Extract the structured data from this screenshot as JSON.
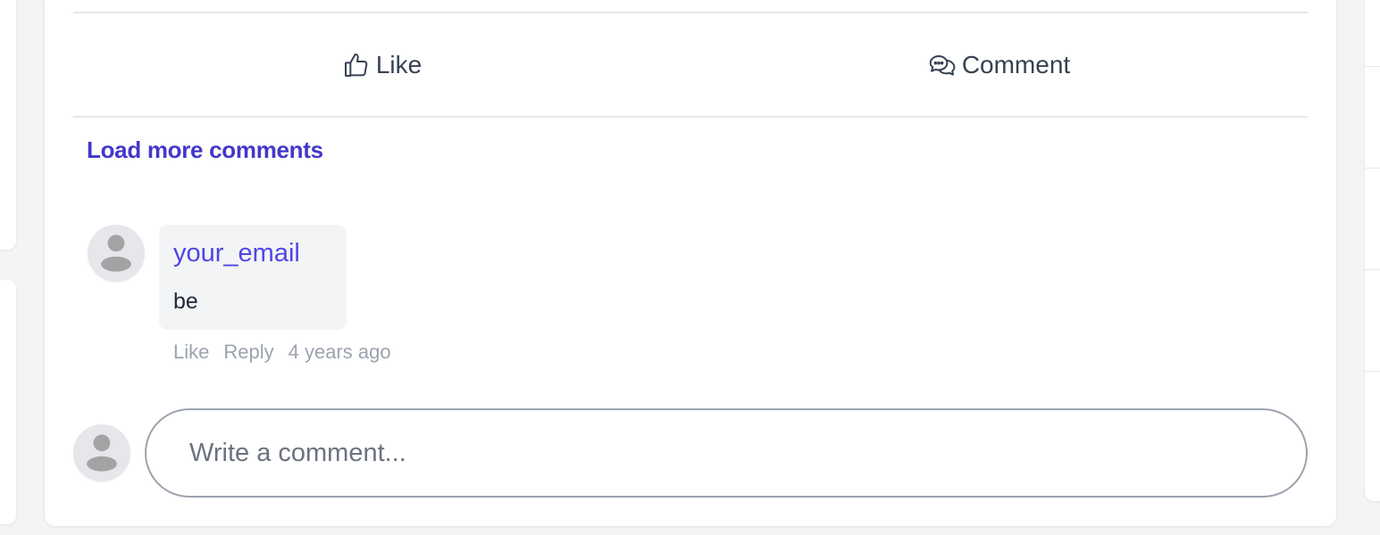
{
  "actions": {
    "like_label": "Like",
    "like_icon": "thumbs-up-icon",
    "comment_label": "Comment",
    "comment_icon": "chat-bubbles-icon"
  },
  "load_more_label": "Load more comments",
  "comments": [
    {
      "author": "your_email",
      "text": "be",
      "like_label": "Like",
      "reply_label": "Reply",
      "time": "4 years ago"
    }
  ],
  "composer": {
    "placeholder": "Write a comment..."
  },
  "colors": {
    "accent": "#4f46e5",
    "load_more": "#4338ca",
    "muted_text": "#9ca3af"
  }
}
